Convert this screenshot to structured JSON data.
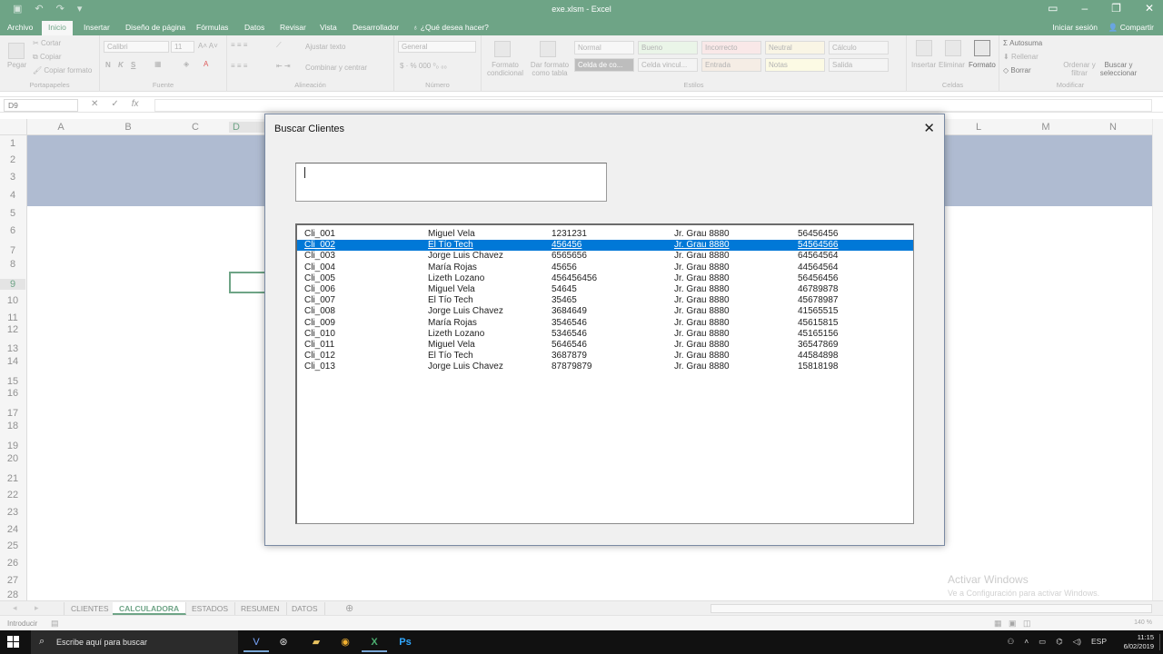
{
  "app": {
    "window_title": "exe.xlsm - Excel",
    "ribbon_tabs": [
      "Archivo",
      "Inicio",
      "Insertar",
      "Diseño de página",
      "Fórmulas",
      "Datos",
      "Revisar",
      "Vista",
      "Desarrollador"
    ],
    "tell_me": "¿Qué desea hacer?",
    "sign_in": "Iniciar sesión",
    "share": "Compartir"
  },
  "ribbon": {
    "clipboard": {
      "paste": "Pegar",
      "cut": "Cortar",
      "copy": "Copiar",
      "format_painter": "Copiar formato",
      "label": "Portapapeles"
    },
    "font": {
      "name": "Calibri",
      "size": "11",
      "bold": "N",
      "italic": "K",
      "underline": "S",
      "label": "Fuente"
    },
    "alignment": {
      "wrap": "Ajustar texto",
      "merge": "Combinar y centrar",
      "label": "Alineación"
    },
    "number": {
      "format": "General",
      "label": "Número"
    },
    "styles": {
      "conditional": "Formato condicional",
      "as_table": "Dar formato como tabla",
      "cells": [
        "Normal",
        "Bueno",
        "Incorrecto",
        "Neutral",
        "Cálculo",
        "Celda de co...",
        "Celda vincul...",
        "Entrada",
        "Notas",
        "Salida"
      ],
      "label": "Estilos"
    },
    "cells": {
      "insert": "Insertar",
      "delete": "Eliminar",
      "format": "Formato",
      "label": "Celdas"
    },
    "editing": {
      "autosum": "Autosuma",
      "fill": "Rellenar",
      "clear": "Borrar",
      "sort": "Ordenar y filtrar",
      "find": "Buscar y seleccionar",
      "label": "Modificar"
    }
  },
  "formula_bar": {
    "name_box": "D9",
    "fx": "fx"
  },
  "grid": {
    "columns": [
      "A",
      "B",
      "C",
      "D",
      "",
      "",
      "",
      "",
      "",
      "",
      "L",
      "M",
      "N"
    ],
    "rows": [
      "1",
      "2",
      "3",
      "4",
      "5",
      "6",
      "7",
      "8",
      "9",
      "10",
      "11",
      "12",
      "13",
      "14",
      "15",
      "16",
      "17",
      "18",
      "19",
      "20",
      "21",
      "22",
      "23",
      "24",
      "25",
      "26",
      "27",
      "28"
    ],
    "selected_cell": "D9"
  },
  "sheets": [
    "CLIENTES",
    "CALCULADORA",
    "ESTADOS",
    "RESUMEN",
    "DATOS"
  ],
  "active_sheet": "CALCULADORA",
  "status": {
    "mode": "Introducir",
    "zoom": "140 %"
  },
  "watermark": {
    "line1": "Activar Windows",
    "line2": "Ve a Configuración para activar Windows."
  },
  "dialog": {
    "title": "Buscar Clientes",
    "search_value": "",
    "selected_index": 1,
    "rows": [
      [
        "Cli_001",
        "Miguel Vela",
        "1231231",
        "Jr. Grau 8880",
        "56456456"
      ],
      [
        "Cli_002",
        "El Tío Tech",
        "456456",
        "Jr. Grau 8880",
        "54564566"
      ],
      [
        "Cli_003",
        "Jorge Luis Chavez",
        "6565656",
        "Jr. Grau 8880",
        "64564564"
      ],
      [
        "Cli_004",
        "María Rojas",
        "45656",
        "Jr. Grau 8880",
        "44564564"
      ],
      [
        "Cli_005",
        "Lizeth Lozano",
        "456456456",
        "Jr. Grau 8880",
        "56456456"
      ],
      [
        "Cli_006",
        "Miguel Vela",
        "54645",
        "Jr. Grau 8880",
        "46789878"
      ],
      [
        "Cli_007",
        "El Tío Tech",
        "35465",
        "Jr. Grau 8880",
        "45678987"
      ],
      [
        "Cli_008",
        "Jorge Luis Chavez",
        "3684649",
        "Jr. Grau 8880",
        "41565515"
      ],
      [
        "Cli_009",
        "María Rojas",
        "3546546",
        "Jr. Grau 8880",
        "45615815"
      ],
      [
        "Cli_010",
        "Lizeth Lozano",
        "5346546",
        "Jr. Grau 8880",
        "45165156"
      ],
      [
        "Cli_011",
        "Miguel Vela",
        "5646546",
        "Jr. Grau 8880",
        "36547869"
      ],
      [
        "Cli_012",
        "El Tío Tech",
        "3687879",
        "Jr. Grau 8880",
        "44584898"
      ],
      [
        "Cli_013",
        "Jorge Luis Chavez",
        "87879879",
        "Jr. Grau 8880",
        "15818198"
      ]
    ]
  },
  "taskbar": {
    "search_placeholder": "Escribe aquí para buscar",
    "language": "ESP",
    "time": "11:15",
    "date": "6/02/2019"
  },
  "colors": {
    "excel_green": "#217346",
    "selection_blue": "#0078d7",
    "banner": "#8497b8"
  }
}
